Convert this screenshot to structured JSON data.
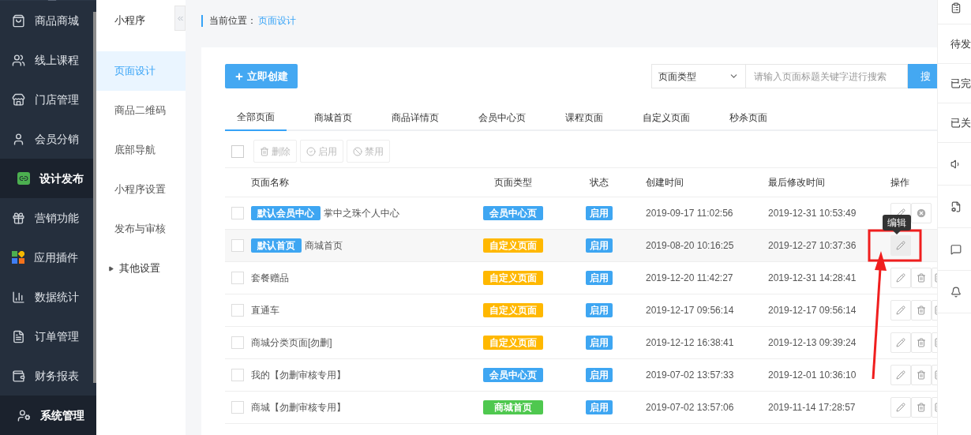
{
  "sidebar": {
    "items": [
      {
        "label": "商品商城",
        "selected": false
      },
      {
        "label": "线上课程",
        "selected": false
      },
      {
        "label": "门店管理",
        "selected": false
      },
      {
        "label": "会员分销",
        "selected": false
      },
      {
        "label": "设计发布",
        "selected": true
      },
      {
        "label": "营销功能",
        "selected": false
      },
      {
        "label": "应用插件",
        "selected": false
      },
      {
        "label": "数据统计",
        "selected": false
      },
      {
        "label": "订单管理",
        "selected": false
      },
      {
        "label": "财务报表",
        "selected": false
      },
      {
        "label": "系统管理",
        "selected": true
      }
    ]
  },
  "submenu": {
    "title": "小程序",
    "items": [
      {
        "label": "页面设计",
        "selected": true
      },
      {
        "label": "商品二维码",
        "selected": false
      },
      {
        "label": "底部导航",
        "selected": false
      },
      {
        "label": "小程序设置",
        "selected": false
      },
      {
        "label": "发布与审核",
        "selected": false
      }
    ],
    "group": {
      "label": "其他设置",
      "expanded": false
    }
  },
  "breadcrumb": {
    "label": "当前位置：",
    "current": "页面设计"
  },
  "toolbar": {
    "create_button": "立即创建",
    "type_select": "页面类型",
    "search": {
      "placeholder": "请输入页面标题关键字进行搜索"
    },
    "search_button": "搜"
  },
  "tabs": [
    {
      "label": "全部页面",
      "selected": true
    },
    {
      "label": "商城首页",
      "selected": false
    },
    {
      "label": "商品详情页",
      "selected": false
    },
    {
      "label": "会员中心页",
      "selected": false
    },
    {
      "label": "课程页面",
      "selected": false
    },
    {
      "label": "自定义页面",
      "selected": false
    },
    {
      "label": "秒杀页面",
      "selected": false
    }
  ],
  "select_all": {
    "checked": false
  },
  "bulk_actions": [
    {
      "label": "删除",
      "kind": "delete",
      "disabled": true
    },
    {
      "label": "启用",
      "kind": "enable",
      "disabled": true
    },
    {
      "label": "禁用",
      "kind": "disable",
      "disabled": true
    }
  ],
  "table": {
    "columns": [
      "页面名称",
      "页面类型",
      "状态",
      "创建时间",
      "最后修改时间",
      "操作"
    ],
    "rows": [
      {
        "checked": false,
        "tag": "默认会员中心",
        "name": "掌中之珠个人中心",
        "type": {
          "label": "会员中心页",
          "color": "#3ea6f2"
        },
        "status": "启用",
        "created": "2019-09-17 11:02:56",
        "modified": "2019-12-31 10:53:49",
        "hovered": false,
        "actions": [
          {
            "kind": "edit"
          },
          {
            "kind": "close"
          }
        ]
      },
      {
        "checked": false,
        "tag": "默认首页",
        "name": "商城首页",
        "type": {
          "label": "自定义页面",
          "color": "#ffb800"
        },
        "status": "启用",
        "created": "2019-08-20 10:16:25",
        "modified": "2019-12-27 10:37:36",
        "hovered": true,
        "actions": [
          {
            "kind": "edit"
          }
        ]
      },
      {
        "checked": false,
        "name": "套餐赠品",
        "type": {
          "label": "自定义页面",
          "color": "#ffb800"
        },
        "status": "启用",
        "created": "2019-12-20 11:42:27",
        "modified": "2019-12-31 14:28:41",
        "hovered": false,
        "actions": [
          {
            "kind": "edit"
          },
          {
            "kind": "delete"
          },
          {
            "kind": "more"
          }
        ]
      },
      {
        "checked": false,
        "name": "直通车",
        "type": {
          "label": "自定义页面",
          "color": "#ffb800"
        },
        "status": "启用",
        "created": "2019-12-17 09:56:14",
        "modified": "2019-12-17 09:56:14",
        "hovered": false,
        "actions": [
          {
            "kind": "edit"
          },
          {
            "kind": "delete"
          },
          {
            "kind": "more"
          }
        ]
      },
      {
        "checked": false,
        "name": "商城分类页面[勿删]",
        "type": {
          "label": "自定义页面",
          "color": "#ffb800"
        },
        "status": "启用",
        "created": "2019-12-12 16:38:41",
        "modified": "2019-12-13 09:39:24",
        "hovered": false,
        "actions": [
          {
            "kind": "edit"
          },
          {
            "kind": "delete"
          },
          {
            "kind": "more"
          }
        ]
      },
      {
        "checked": false,
        "name": "我的【勿删审核专用】",
        "type": {
          "label": "会员中心页",
          "color": "#3ea6f2"
        },
        "status": "启用",
        "created": "2019-07-02 13:57:33",
        "modified": "2019-12-01 10:36:10",
        "hovered": false,
        "actions": [
          {
            "kind": "edit"
          },
          {
            "kind": "delete"
          },
          {
            "kind": "more"
          }
        ]
      },
      {
        "checked": false,
        "name": "商城【勿删审核专用】",
        "type": {
          "label": "商城首页",
          "color": "#4fc84f"
        },
        "status": "启用",
        "created": "2019-07-02 13:57:06",
        "modified": "2019-11-14 17:28:57",
        "hovered": false,
        "actions": [
          {
            "kind": "edit"
          },
          {
            "kind": "delete"
          },
          {
            "kind": "more"
          }
        ]
      }
    ]
  },
  "tooltip": "编辑",
  "right_panel": [
    {
      "kind": "icon"
    },
    {
      "kind": "text",
      "label": "待发"
    },
    {
      "kind": "text",
      "label": "已完"
    },
    {
      "kind": "text",
      "label": "已关"
    },
    {
      "kind": "icon"
    },
    {
      "kind": "icon"
    },
    {
      "kind": "icon"
    },
    {
      "kind": "icon"
    }
  ]
}
